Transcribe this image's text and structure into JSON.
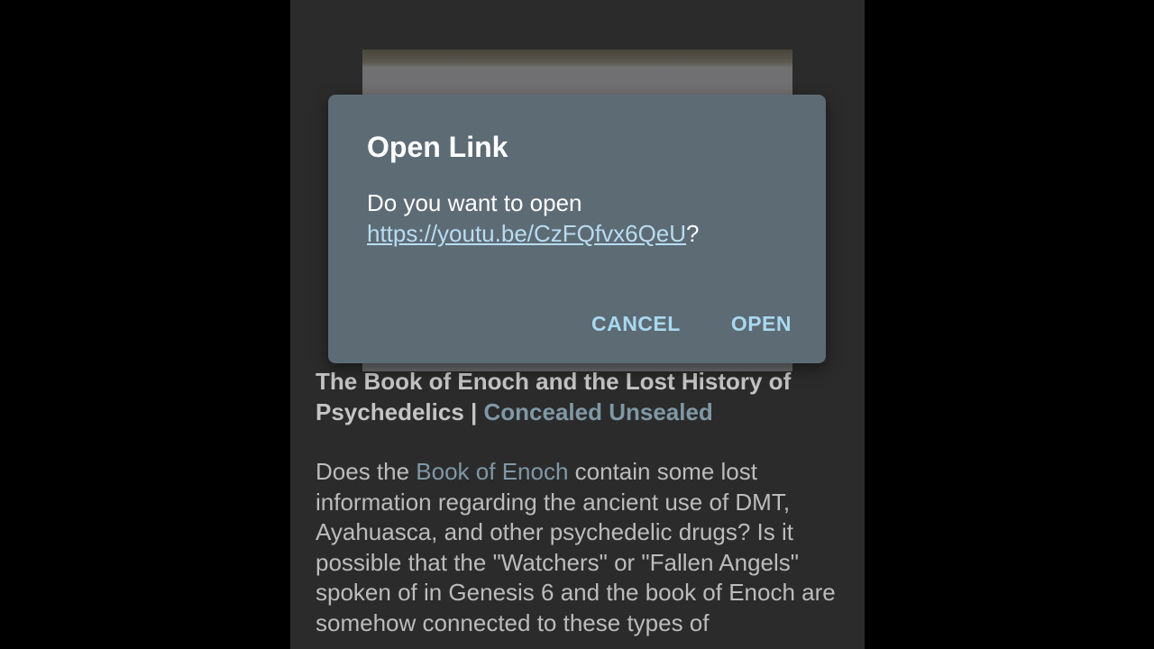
{
  "post": {
    "title_text": "The Book of Enoch and the Lost History of Psychedelics | ",
    "title_link": "Concealed Unsealed",
    "body_intro": " Does the ",
    "body_link": "Book of Enoch",
    "body_rest": " contain some lost information regarding the ancient use of DMT, Ayahuasca, and other psychedelic drugs? Is it possible that the \"Watchers\" or \"Fallen Angels\" spoken of in Genesis 6 and the book of Enoch are somehow connected to these types of"
  },
  "dialog": {
    "title": "Open Link",
    "message_prefix": "Do you want to open ",
    "url": "https://youtu.be/CzFQfvx6QeU",
    "message_suffix": "?",
    "cancel_label": "CANCEL",
    "open_label": "OPEN"
  },
  "colors": {
    "dialog_bg": "#5d6b75",
    "button_accent": "#a9d8ef",
    "link_accent": "#7f98a6"
  }
}
